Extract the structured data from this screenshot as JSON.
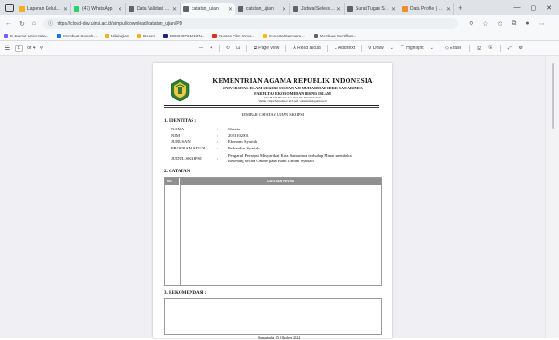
{
  "browser": {
    "tabs": [
      {
        "title": "Laporan Kelulusan",
        "color": "#f2b01e",
        "active": false
      },
      {
        "title": "(47) WhatsApp",
        "color": "#25d366",
        "active": false
      },
      {
        "title": "Data Validasi Judul",
        "color": "#5f6368",
        "active": false
      },
      {
        "title": "catatan_ujian",
        "color": "#5f6368",
        "active": true
      },
      {
        "title": "catatan_ujian",
        "color": "#5f6368",
        "active": false
      },
      {
        "title": "Jadwal Seleksi Judul",
        "color": "#5f6368",
        "active": false
      },
      {
        "title": "Surat Tugas Seleks",
        "color": "#5f6368",
        "active": false
      },
      {
        "title": "Data Profile | Layan",
        "color": "#f28b2c",
        "active": false
      }
    ],
    "url": "https://cloud-dev.uinsi.ac.id/simpul/download/catatan_ujian/PD",
    "bookmarks": [
      {
        "label": "E-Journal Universita...",
        "color": "#7a5af8"
      },
      {
        "label": "Membuat Contoh...",
        "color": "#1a73e8"
      },
      {
        "label": "Nilai Ujian",
        "color": "#f2b01e"
      },
      {
        "label": "Dedori",
        "color": "#f2b01e"
      },
      {
        "label": "BIOSKOP21 NON...",
        "color": "#1a237e"
      },
      {
        "label": "Nonton Film Immo...",
        "color": "#d93025"
      },
      {
        "label": "Immortal Samsara ...",
        "color": "#fbbc04"
      },
      {
        "label": "Membuat Sertifikat...",
        "color": "#5f6368"
      }
    ]
  },
  "pdf_toolbar": {
    "page_current": "1",
    "page_total": "of 4",
    "page_view": "Page view",
    "read_aloud": "Read aloud",
    "add_text": "Add text",
    "draw": "Draw",
    "highlight": "Highlight",
    "erase": "Erase"
  },
  "document": {
    "kop_title": "KEMENTRIAN AGAMA REPUBLIK INDONESIA",
    "kop_univ": "UNIVERSITAS ISLAM NEGERI SULTAN AJI MUHAMMAD IDRIS SAMARINDA",
    "kop_faculty": "FAKULTAS EKONOMI DAN BISNIS ISLAM",
    "kop_address": "Jalan H.A.M Rifaddin, Loa Janan Ilir, Samarinda 75131",
    "kop_contact": "Website : https://febi.uinsi.ac.id E-mail : umsamarinda@uinsi.ac.id",
    "lembar": "LEMBAR CATATAN UJIAN SKRIPSI",
    "sec_identitas": "1. IDENTITAS :",
    "fields": [
      {
        "label": "NAMA",
        "colon": ":",
        "value": "Shintia"
      },
      {
        "label": "NIM",
        "colon": ":",
        "value": "2023102001"
      },
      {
        "label": "JURUSAN",
        "colon": ":",
        "value": "Ekonomi Syariah"
      },
      {
        "label": "PROGRAM STUDI",
        "colon": ":",
        "value": "Perbankan Syariah"
      },
      {
        "label": "JUDUL SKRIPSI",
        "colon": ":",
        "value": "Pengaruh Persepsi Masyarakat Kota Samarinda terhadap Minat membuka Rekening secara Online pada Bank Umum Syariah"
      }
    ],
    "sec_catatan": "2. CATATAN :",
    "table_no": "NO.",
    "table_rev": "CATATAN REVISI",
    "sec_rekomendasi": "3. REKOMENDASI :",
    "footer": "Samarinda, 15 Oktober 2024"
  }
}
